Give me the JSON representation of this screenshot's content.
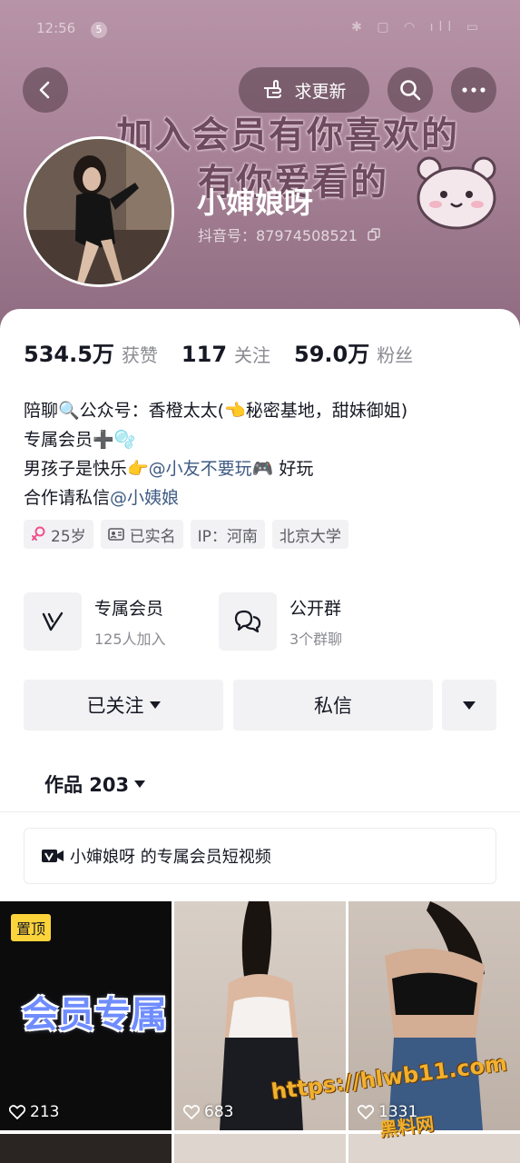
{
  "status_bar": {
    "time": "12:56",
    "badge": "5",
    "right": "✱ ▢ ◠ ıll ▭"
  },
  "header": {
    "banner_line1": "加入会员有你喜欢的",
    "banner_line2": "有你爱看的",
    "update_label": "求更新",
    "nickname": "小婶娘呀",
    "douyin_id": "抖音号：87974508521"
  },
  "stats": [
    {
      "num": "534.5万",
      "label": "获赞"
    },
    {
      "num": "117",
      "label": "关注"
    },
    {
      "num": "59.0万",
      "label": "粉丝"
    }
  ],
  "bio": {
    "line1": "陪聊🔍公众号：香橙太太(👈秘密基地，甜妹御姐)",
    "line2": "专属会员➕🫧",
    "line3_prefix": "男孩子是快乐👉",
    "line3_link": "@小友不要玩",
    "line3_suffix": "🎮 好玩",
    "line4_prefix": "合作请私信",
    "line4_link": "@小姨娘"
  },
  "tags": [
    {
      "icon": "female-icon",
      "label": "25岁"
    },
    {
      "icon": "id-card-icon",
      "label": "已实名"
    },
    {
      "icon": "",
      "label": "IP：河南"
    },
    {
      "icon": "",
      "label": "北京大学"
    }
  ],
  "features": {
    "member": {
      "title": "专属会员",
      "sub": "125人加入"
    },
    "group": {
      "title": "公开群",
      "sub": "3个群聊"
    }
  },
  "buttons": {
    "followed": "已关注",
    "message": "私信"
  },
  "works": {
    "label": "作品 203"
  },
  "member_videos": {
    "label": "小婶娘呀 的专属会员短视频"
  },
  "grid": [
    {
      "pin": "置顶",
      "overlay": "会员专属",
      "likes": "213"
    },
    {
      "likes": "683"
    },
    {
      "likes": "1331"
    }
  ],
  "watermark": {
    "url": "https://hlwb11.com",
    "name": "黑料网"
  },
  "colors": {
    "link": "#3e5a83",
    "pin": "#fcd33a",
    "tag_bg": "#f2f2f4"
  }
}
